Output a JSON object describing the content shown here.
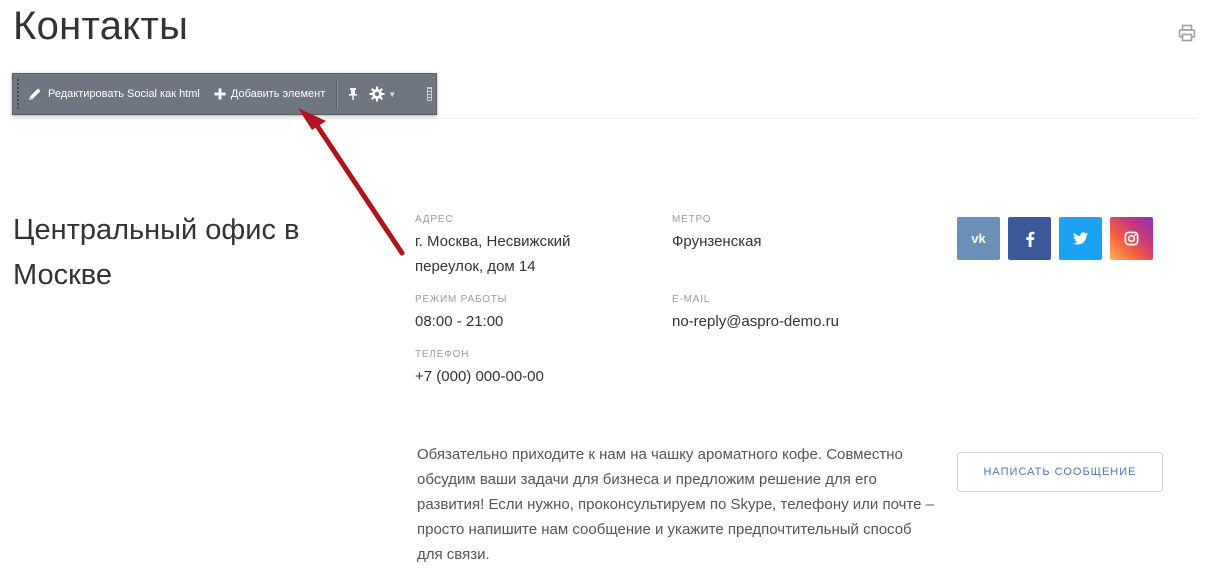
{
  "page": {
    "title": "Контакты"
  },
  "toolbar": {
    "edit_label": "Редактировать Social как html",
    "add_label": "Добавить элемент"
  },
  "office": {
    "title": "Центральный офис в Москве",
    "address_label": "Адрес",
    "address_line1": "г. Москва, Несвижский",
    "address_line2": "переулок, дом 14",
    "metro_label": "Метро",
    "metro_value": "Фрунзенская",
    "hours_label": "Режим работы",
    "hours_value": "08:00 - 21:00",
    "email_label": "E-mail",
    "email_value": "no-reply@aspro-demo.ru",
    "phone_label": "Телефон",
    "phone_value": "+7 (000) 000-00-00"
  },
  "socials": [
    {
      "name": "vk",
      "icon": "vk-icon",
      "color": "#6a90b7"
    },
    {
      "name": "facebook",
      "icon": "facebook-icon",
      "color": "#3b5998"
    },
    {
      "name": "twitter",
      "icon": "twitter-icon",
      "color": "#1da1f2"
    },
    {
      "name": "instagram",
      "icon": "instagram-icon",
      "color": "#e1306c"
    }
  ],
  "description": "Обязательно приходите к нам на чашку ароматного кофе. Совместно обсудим ваши задачи для бизнеса и предложим решение для его развития! Если нужно, проконсультируем по Skype, телефону или почте – просто напишите нам сообщение и укажите предпочтительный способ для связи.",
  "actions": {
    "write_message": "Написать сообщение"
  },
  "colors": {
    "accent": "#4a78b5",
    "annotation_arrow": "#b0141c",
    "toolbar_bg": "#6f7682"
  }
}
